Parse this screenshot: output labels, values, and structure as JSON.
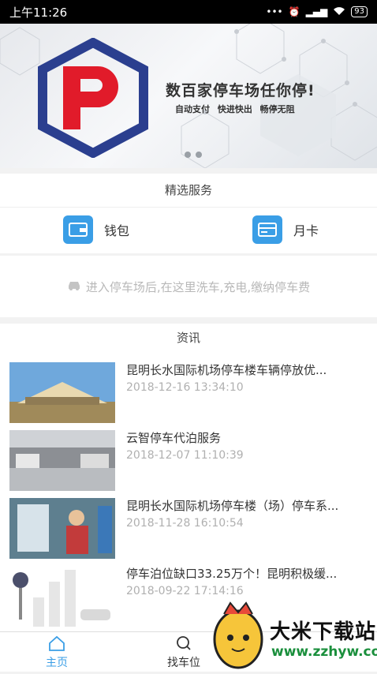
{
  "status_bar": {
    "time": "上午11:26",
    "battery": "93"
  },
  "banner": {
    "logo_letter": "P",
    "slogan": "数百家停车场任你停!",
    "subslogan": "自动支付 快进快出 畅停无阻"
  },
  "featured": {
    "title": "精选服务",
    "items": [
      {
        "label": "钱包",
        "icon": "wallet-icon"
      },
      {
        "label": "月卡",
        "icon": "card-icon"
      }
    ]
  },
  "hint": {
    "text": "进入停车场后,在这里洗车,充电,缴纳停车费",
    "icon": "car-icon"
  },
  "news": {
    "title": "资讯",
    "items": [
      {
        "title": "昆明长水国际机场停车楼车辆停放优...",
        "date": "2018-12-16 13:34:10"
      },
      {
        "title": "云智停车代泊服务",
        "date": "2018-12-07 11:10:39"
      },
      {
        "title": "昆明长水国际机场停车楼（场）停车系...",
        "date": "2018-11-28 16:10:54"
      },
      {
        "title": "停车泊位缺口33.25万个！昆明积极缓...",
        "date": "2018-09-22 17:14:16"
      }
    ]
  },
  "tabbar": {
    "items": [
      {
        "label": "主页",
        "icon": "home-icon"
      },
      {
        "label": "找车位",
        "icon": "search-icon"
      }
    ]
  },
  "watermark": {
    "text": "大米下载站",
    "url": "www.zzhyw.com"
  },
  "colors": {
    "accent": "#3a9ee6",
    "logo_blue": "#2b3f8f",
    "logo_red": "#e11b2a"
  }
}
